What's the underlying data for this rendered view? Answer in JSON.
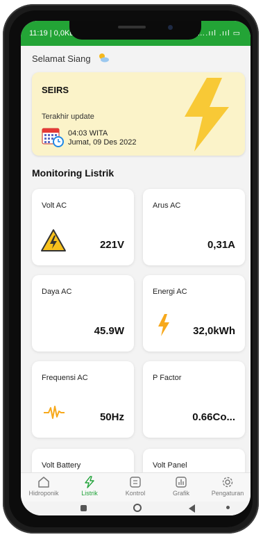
{
  "status_bar": {
    "time": "11:19 | 0,0KB",
    "right": "….ııl .ııl ▭"
  },
  "greeting": "Selamat Siang",
  "info_card": {
    "brand": "SEIRS",
    "last_update_label": "Terakhir update",
    "time": "04:03 WITA",
    "date": "Jumat, 09 Des 2022"
  },
  "section_title": "Monitoring Listrik",
  "cards": [
    {
      "label": "Volt AC",
      "value": "221V",
      "icon": "warning-bolt-icon"
    },
    {
      "label": "Arus AC",
      "value": "0,31A",
      "icon": ""
    },
    {
      "label": "Daya AC",
      "value": "45.9W",
      "icon": ""
    },
    {
      "label": "Energi AC",
      "value": "32,0kWh",
      "icon": "bolt-icon"
    },
    {
      "label": "Frequensi AC",
      "value": "50Hz",
      "icon": "waveform-icon"
    },
    {
      "label": "P Factor",
      "value": "0.66Co...",
      "icon": ""
    },
    {
      "label": "Volt Battery",
      "value": "",
      "icon": ""
    },
    {
      "label": "Volt Panel",
      "value": "",
      "icon": ""
    }
  ],
  "bottom_nav": [
    {
      "label": "Hidroponik",
      "icon": "house-icon",
      "active": false
    },
    {
      "label": "Listrik",
      "icon": "bolt-icon",
      "active": true
    },
    {
      "label": "Kontrol",
      "icon": "control-icon",
      "active": false
    },
    {
      "label": "Grafik",
      "icon": "chart-icon",
      "active": false
    },
    {
      "label": "Pengaturan",
      "icon": "gear-icon",
      "active": false
    }
  ],
  "colors": {
    "primary_green": "#23a436",
    "card_yellow": "#fbf3c9",
    "bolt_yellow": "#f7c11c"
  }
}
